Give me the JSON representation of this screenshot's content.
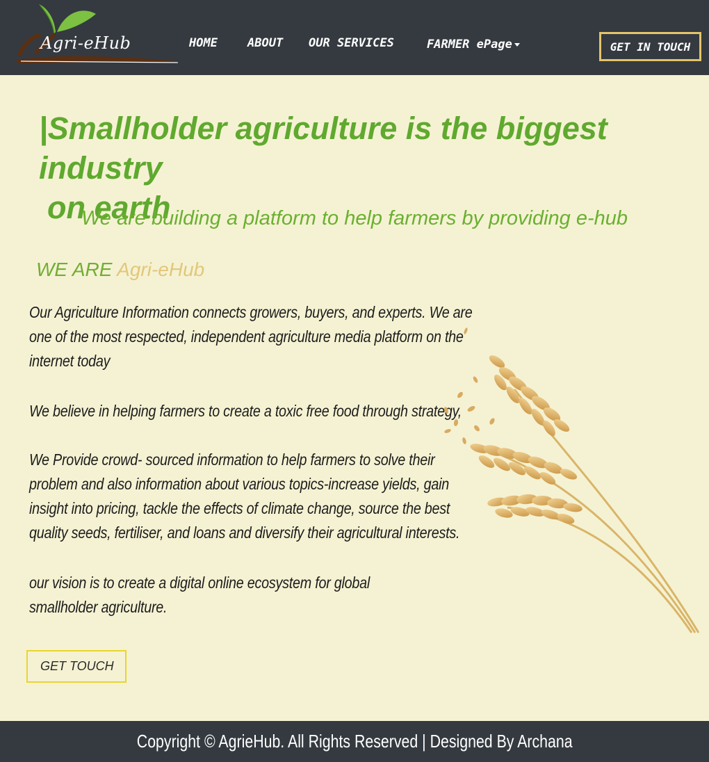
{
  "brand": {
    "logo_text": "Agri-eHub",
    "colors": {
      "nav_bg": "#343a40",
      "page_bg": "#f5f2d3",
      "accent_green": "#5fa92f",
      "accent_gold": "#e4c46a",
      "cta_border": "#e9d52f"
    }
  },
  "nav": {
    "home": "HOME",
    "about": "ABOUT",
    "services": "OUR SERVICES",
    "farmer": "FARMER ePage",
    "cta": "GET IN TOUCH"
  },
  "hero": {
    "title_line1": "|Smallholder agriculture is the biggest industry",
    "title_line2": "on earth",
    "subtitle": "We are building a platform to help farmers by providing e-hub"
  },
  "about": {
    "prefix": "WE ARE ",
    "brand": "Agri-eHub",
    "paragraphs": [
      "Our Agriculture Information connects growers, buyers, and experts. We are one of the most respected, independent agriculture media platform on the internet today",
      "We believe in helping farmers to create a toxic free food through strategy,",
      "We Provide crowd- sourced information to help farmers to solve their problem and also information about various topics-increase yields, gain insight into pricing, tackle the effects of climate change, source the best quality seeds, fertiliser, and loans and diversify their agricultural interests.",
      "our vision is to create a digital online ecosystem for global smallholder agriculture."
    ],
    "cta": "GET TOUCH"
  },
  "footer": {
    "text": "Copyright © AgrieHub. All Rights Reserved | Designed By Archana"
  },
  "icons": {
    "logo": "leaf-logo-icon",
    "dropdown": "caret-down-icon",
    "decoration": "wheat-image"
  }
}
